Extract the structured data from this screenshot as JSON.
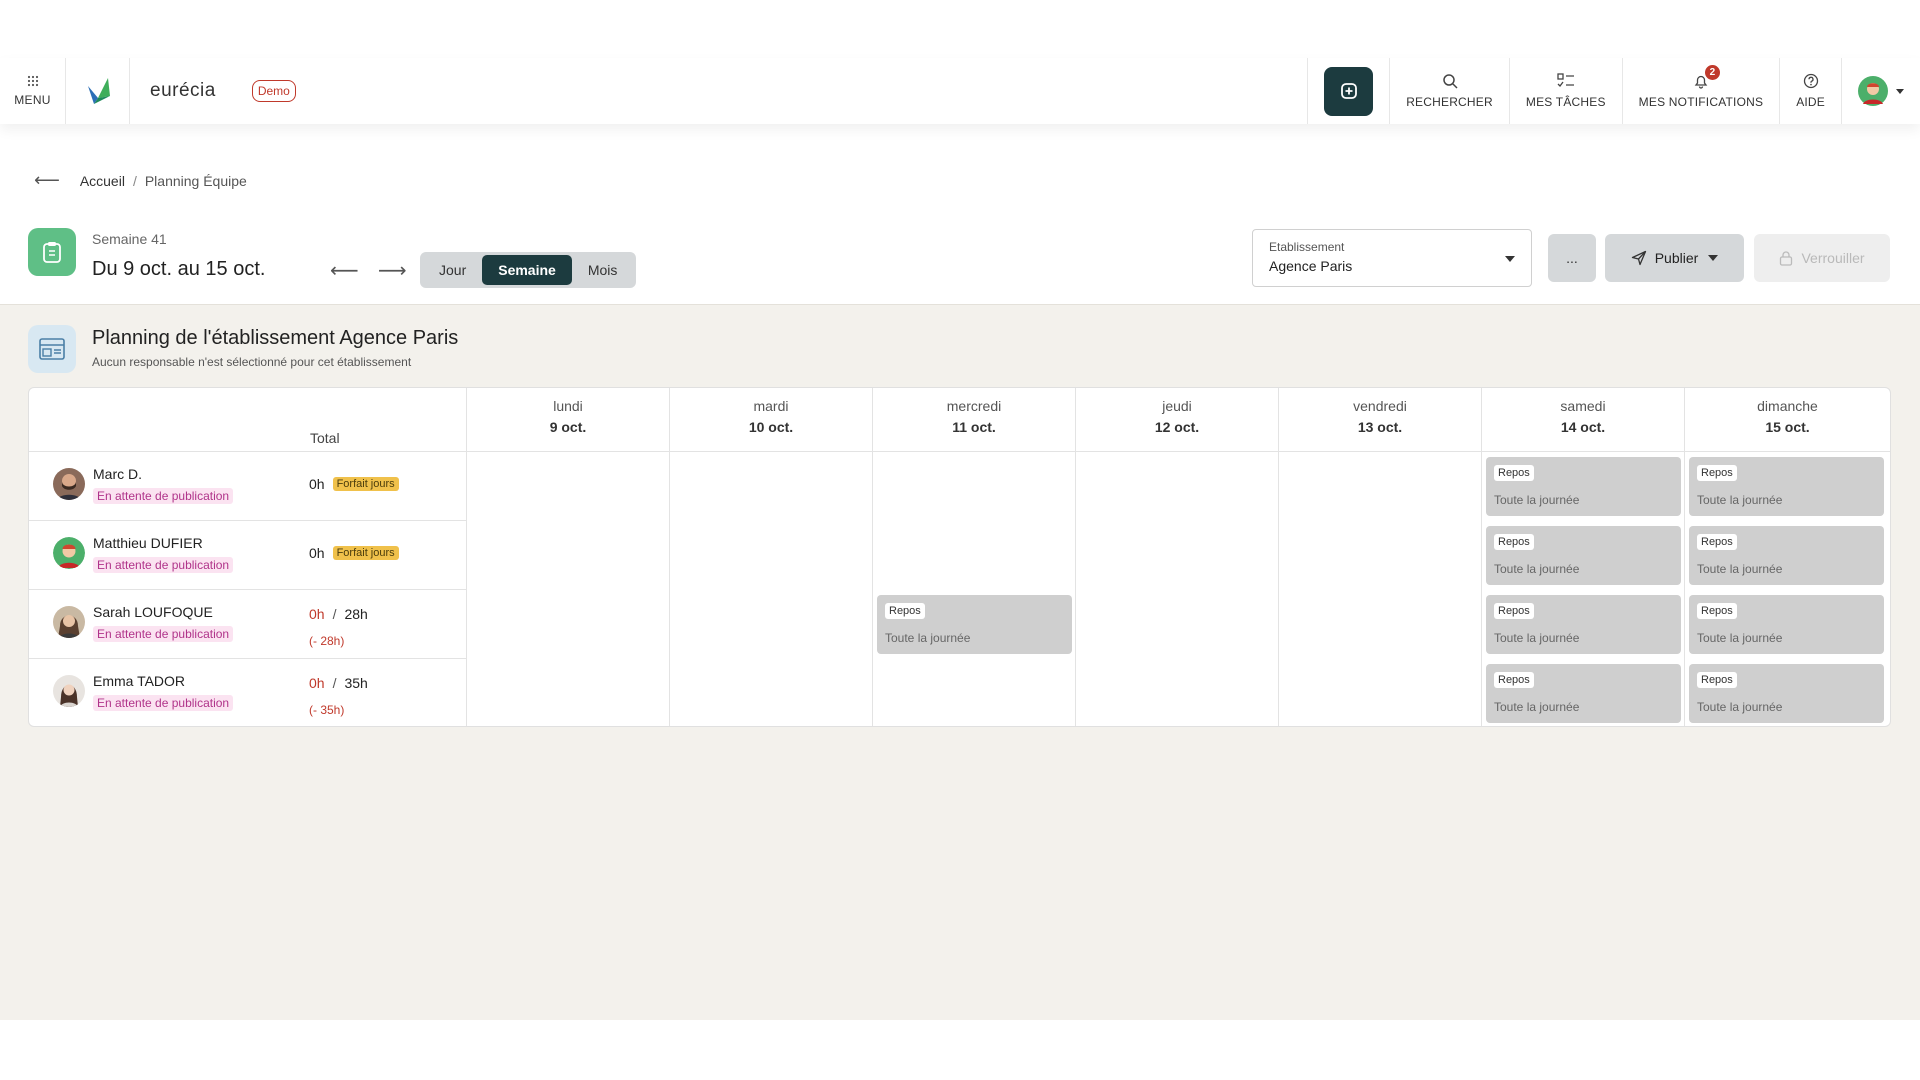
{
  "header": {
    "menu_label": "MENU",
    "brand": "eurécia",
    "demo_badge": "Demo",
    "nav": [
      {
        "label": "RECHERCHER",
        "icon": "search-icon"
      },
      {
        "label": "MES TÂCHES",
        "icon": "tasks-icon"
      },
      {
        "label": "MES NOTIFICATIONS",
        "icon": "bell-icon",
        "count": "2"
      },
      {
        "label": "AIDE",
        "icon": "help-icon"
      }
    ]
  },
  "breadcrumb": {
    "home": "Accueil",
    "sep": "/",
    "current": "Planning Équipe"
  },
  "week": {
    "label": "Semaine 41",
    "range": "Du 9 oct. au 15 oct.",
    "views": [
      "Jour",
      "Semaine",
      "Mois"
    ],
    "active_view": "Semaine"
  },
  "etablissement": {
    "label": "Etablissement",
    "value": "Agence Paris"
  },
  "actions": {
    "more": "...",
    "publish": "Publier",
    "lock": "Verrouiller"
  },
  "planning": {
    "title": "Planning de l'établissement Agence Paris",
    "subtitle": "Aucun responsable n'est sélectionné pour cet établissement",
    "total_header": "Total",
    "days": [
      {
        "name": "lundi",
        "date": "9 oct."
      },
      {
        "name": "mardi",
        "date": "10 oct."
      },
      {
        "name": "mercredi",
        "date": "11 oct."
      },
      {
        "name": "jeudi",
        "date": "12 oct."
      },
      {
        "name": "vendredi",
        "date": "13 oct."
      },
      {
        "name": "samedi",
        "date": "14 oct."
      },
      {
        "name": "dimanche",
        "date": "15 oct."
      }
    ],
    "employees": [
      {
        "name": "Marc D.",
        "status": "En attente de publication",
        "hours": "0h",
        "badge": "Forfait jours"
      },
      {
        "name": "Matthieu DUFIER",
        "status": "En attente de publication",
        "hours": "0h",
        "badge": "Forfait jours"
      },
      {
        "name": "Sarah LOUFOQUE",
        "status": "En attente de publication",
        "hours": "0h",
        "slash": "/",
        "target": "28h",
        "deficit": "(- 28h)"
      },
      {
        "name": "Emma TADOR",
        "status": "En attente de publication",
        "hours": "0h",
        "slash": "/",
        "target": "35h",
        "deficit": "(- 35h)"
      }
    ],
    "event": {
      "tag": "Repos",
      "desc": "Toute la journée"
    }
  },
  "colors": {
    "accent": "#1c3b3f",
    "success": "#5fbf86",
    "danger": "#c0392b",
    "pending": "#b0338a"
  }
}
